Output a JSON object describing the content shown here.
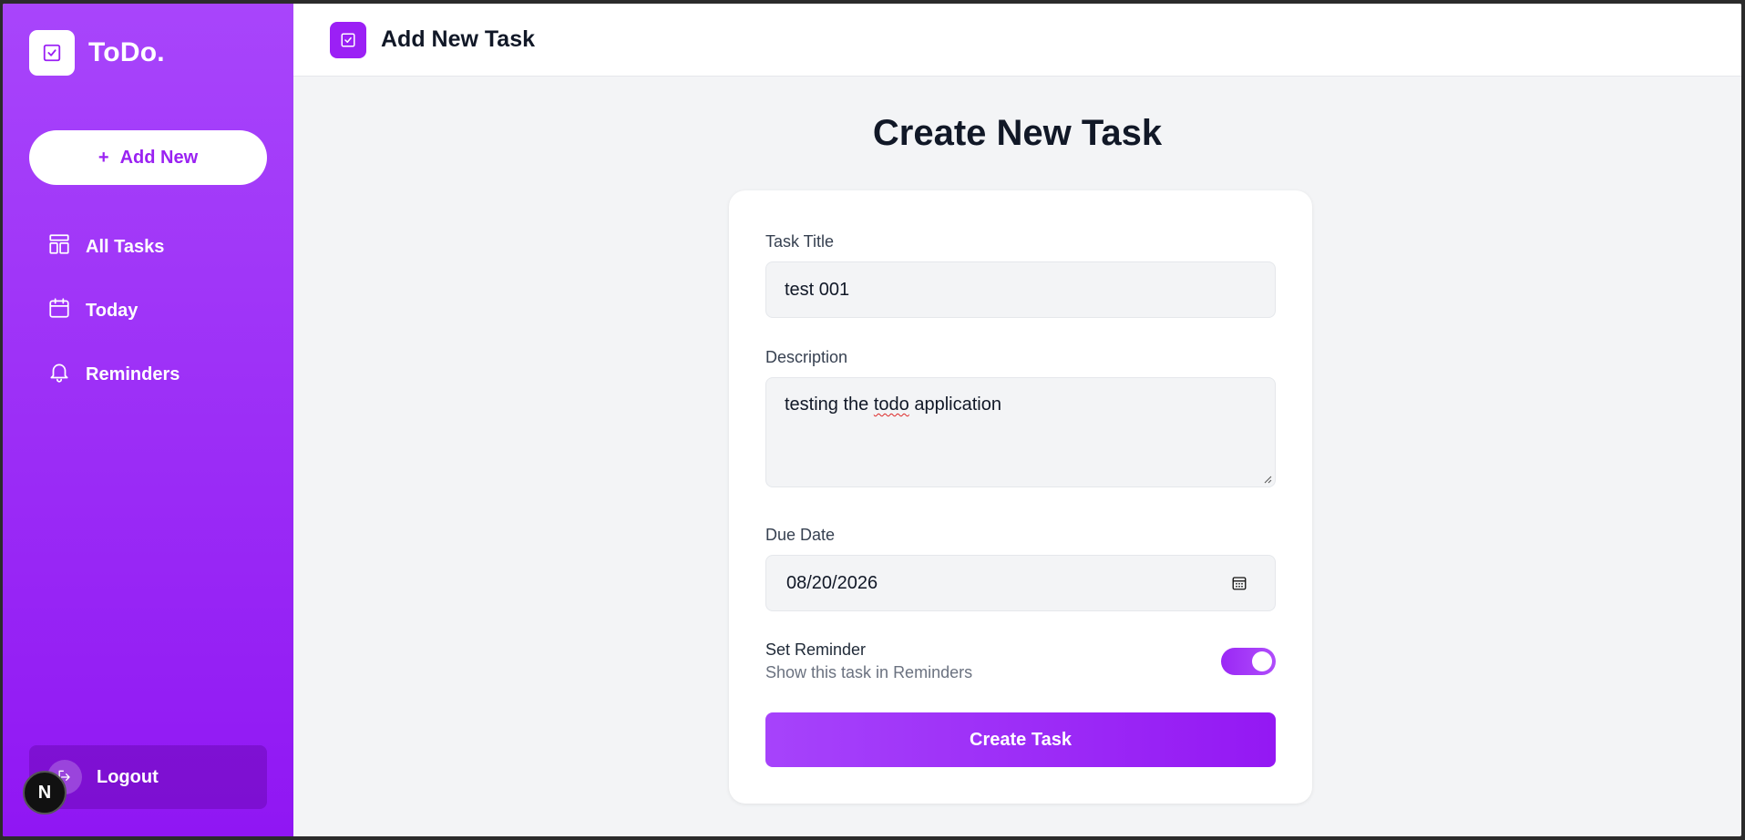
{
  "app": {
    "brand_name": "ToDo."
  },
  "sidebar": {
    "add_new_label": "Add New",
    "add_new_icon": "+",
    "items": [
      {
        "label": "All Tasks",
        "icon": "layout-icon"
      },
      {
        "label": "Today",
        "icon": "calendar-icon"
      },
      {
        "label": "Reminders",
        "icon": "bell-icon"
      }
    ],
    "logout_label": "Logout",
    "dev_badge": "N"
  },
  "header": {
    "title": "Add New Task",
    "icon": "checkbox-icon"
  },
  "form": {
    "heading": "Create New Task",
    "task_title": {
      "label": "Task Title",
      "value": "test 001"
    },
    "description": {
      "label": "Description",
      "value_before": "testing the ",
      "value_flagged": "todo",
      "value_after": " application"
    },
    "due_date": {
      "label": "Due Date",
      "value": "08/20/2026"
    },
    "reminder": {
      "label": "Set Reminder",
      "sublabel": "Show this task in Reminders",
      "enabled": true
    },
    "submit_label": "Create Task"
  },
  "colors": {
    "accent": "#9b20f5",
    "accent_light": "#a845fb",
    "background": "#f3f4f6"
  }
}
